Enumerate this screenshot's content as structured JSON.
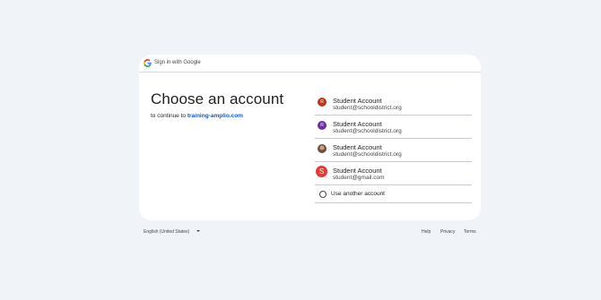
{
  "header": {
    "text": "Sign in with Google"
  },
  "main": {
    "title": "Choose an account",
    "subtitle_prefix": "to continue to ",
    "subtitle_link": "training-amplio.com"
  },
  "accounts": [
    {
      "name": "Student Account",
      "email": "student@schooldistrict.org",
      "initial": "R",
      "color": "#b8391b"
    },
    {
      "name": "Student Account",
      "email": "student@schooldistrict.org",
      "initial": "R",
      "color": "#6b2fa3"
    },
    {
      "name": "Student Account",
      "email": "student@schooldistrict.org",
      "initial": "",
      "color": "#8d6e63"
    },
    {
      "name": "Student Account",
      "email": "student@gmail.com",
      "initial": "S",
      "color": "#e53935"
    }
  ],
  "use_another": "Use another account",
  "footer": {
    "language": "English (United States)",
    "help": "Help",
    "privacy": "Privacy",
    "terms": "Terms"
  }
}
